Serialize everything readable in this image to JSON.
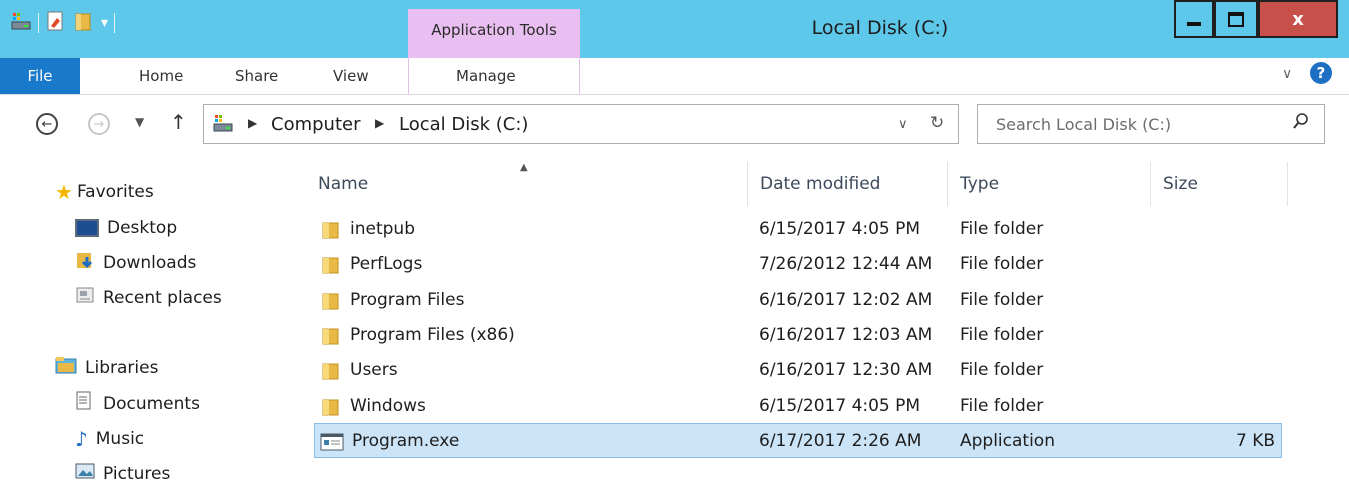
{
  "window": {
    "title": "Local Disk (C:)",
    "context_tab": "Application Tools"
  },
  "ribbon": {
    "tabs": [
      "File",
      "Home",
      "Share",
      "View",
      "Manage"
    ]
  },
  "address": {
    "crumbs": [
      "Computer",
      "Local Disk (C:)"
    ],
    "search_placeholder": "Search Local Disk (C:)"
  },
  "nav": {
    "favorites_label": "Favorites",
    "favorites": [
      "Desktop",
      "Downloads",
      "Recent places"
    ],
    "libraries_label": "Libraries",
    "libraries": [
      "Documents",
      "Music",
      "Pictures"
    ]
  },
  "columns": {
    "name": "Name",
    "date": "Date modified",
    "type": "Type",
    "size": "Size"
  },
  "files": [
    {
      "name": "inetpub",
      "date": "6/15/2017 4:05 PM",
      "type": "File folder",
      "size": ""
    },
    {
      "name": "PerfLogs",
      "date": "7/26/2012 12:44 AM",
      "type": "File folder",
      "size": ""
    },
    {
      "name": "Program Files",
      "date": "6/16/2017 12:02 AM",
      "type": "File folder",
      "size": ""
    },
    {
      "name": "Program Files (x86)",
      "date": "6/16/2017 12:03 AM",
      "type": "File folder",
      "size": ""
    },
    {
      "name": "Users",
      "date": "6/16/2017 12:30 AM",
      "type": "File folder",
      "size": ""
    },
    {
      "name": "Windows",
      "date": "6/15/2017 4:05 PM",
      "type": "File folder",
      "size": ""
    },
    {
      "name": "Program.exe",
      "date": "6/17/2017 2:26 AM",
      "type": "Application",
      "size": "7 KB"
    }
  ],
  "colors": {
    "titlebar": "#5ec8ea",
    "context_tab": "#e8bff0",
    "file_tab": "#1979ca",
    "selection": "#cce4f7",
    "close_button": "#c7504a"
  },
  "icons": {
    "favorites": "star-icon",
    "libraries": "library-icon",
    "folder": "folder-icon",
    "application": "application-icon",
    "help": "help-icon"
  }
}
